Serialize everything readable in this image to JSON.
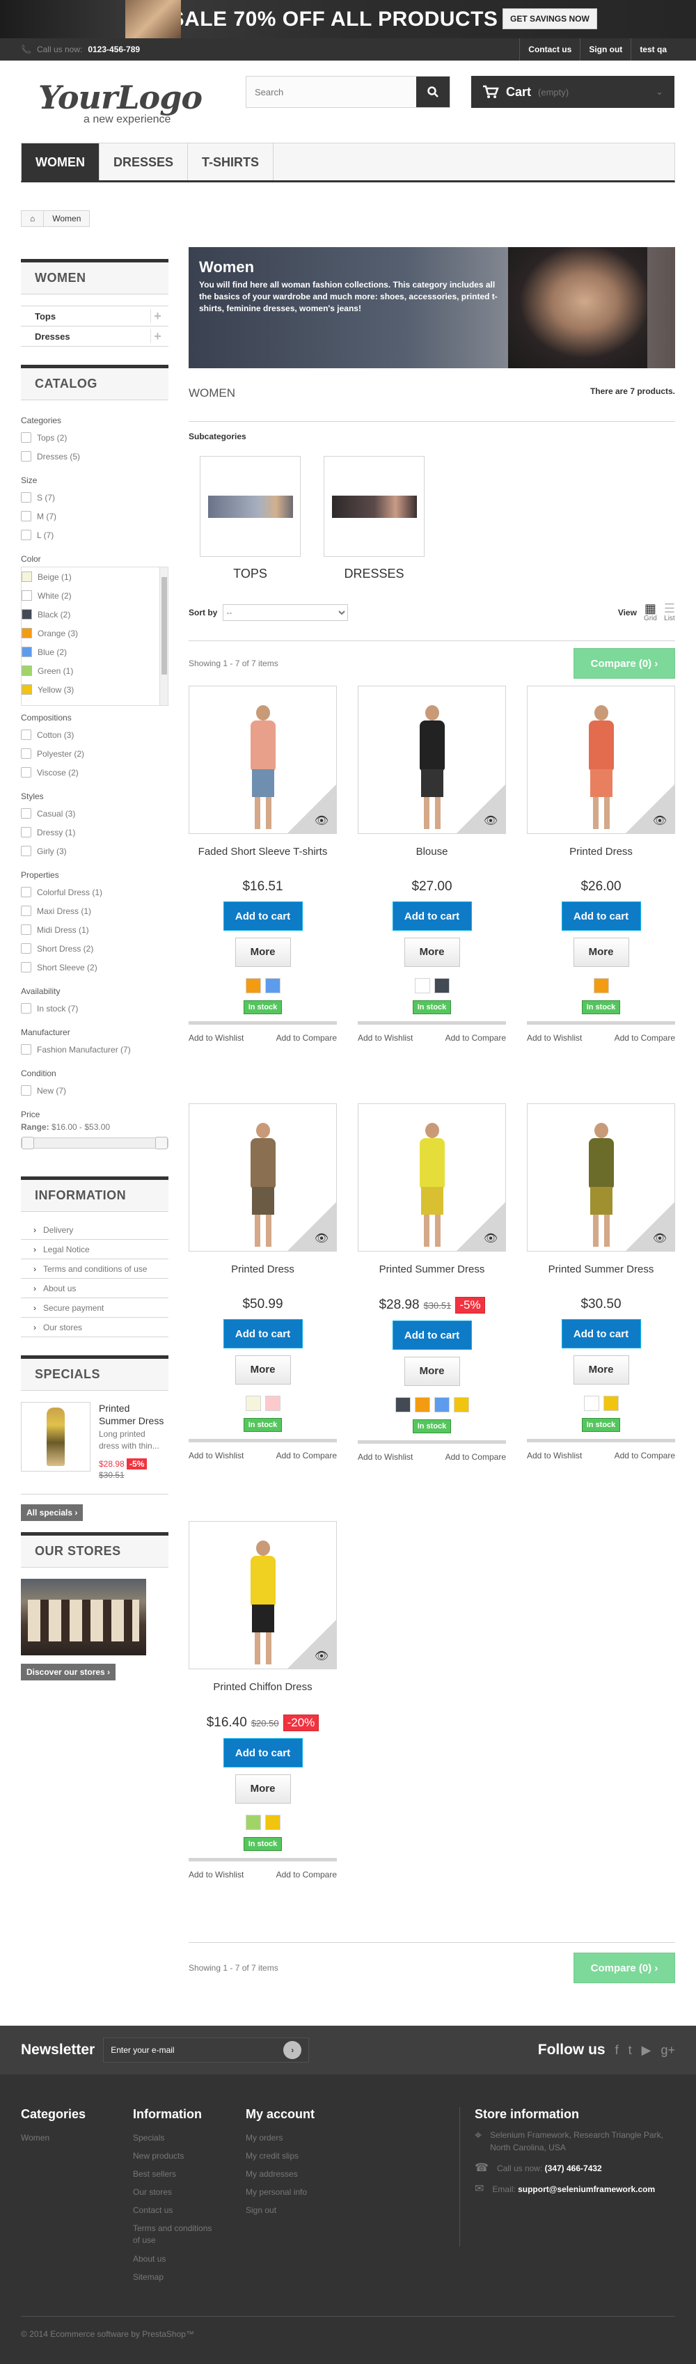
{
  "banner": {
    "sale": "SALE 70% OFF ALL PRODUCTS",
    "cta": "GET SAVINGS NOW"
  },
  "nav": {
    "call_label": "Call us now:",
    "phone": "0123-456-789",
    "links": [
      "Contact us",
      "Sign out",
      "test qa"
    ]
  },
  "header": {
    "logo_text": "YourLogo",
    "logo_tagline": "a new experience",
    "search_placeholder": "Search",
    "cart_label": "Cart",
    "cart_state": "(empty)"
  },
  "menu": [
    "WOMEN",
    "DRESSES",
    "T-SHIRTS"
  ],
  "breadcrumb": "Women",
  "sidebar": {
    "women_title": "WOMEN",
    "categories": [
      "Tops",
      "Dresses"
    ],
    "catalog_title": "CATALOG",
    "facets": {
      "categories_label": "Categories",
      "categories": [
        "Tops (2)",
        "Dresses (5)"
      ],
      "size_label": "Size",
      "sizes": [
        "S (7)",
        "M (7)",
        "L (7)"
      ],
      "color_label": "Color",
      "colors": [
        {
          "label": "Beige (1)",
          "hex": "#f5f5dc"
        },
        {
          "label": "White (2)",
          "hex": "#ffffff"
        },
        {
          "label": "Black (2)",
          "hex": "#434A54"
        },
        {
          "label": "Orange (3)",
          "hex": "#F39C11"
        },
        {
          "label": "Blue (2)",
          "hex": "#5D9CEC"
        },
        {
          "label": "Green (1)",
          "hex": "#A0D468"
        },
        {
          "label": "Yellow (3)",
          "hex": "#F1C40F"
        }
      ],
      "compositions_label": "Compositions",
      "compositions": [
        "Cotton (3)",
        "Polyester (2)",
        "Viscose (2)"
      ],
      "styles_label": "Styles",
      "styles": [
        "Casual (3)",
        "Dressy (1)",
        "Girly (3)"
      ],
      "properties_label": "Properties",
      "properties": [
        "Colorful Dress (1)",
        "Maxi Dress (1)",
        "Midi Dress (1)",
        "Short Dress (2)",
        "Short Sleeve (2)"
      ],
      "availability_label": "Availability",
      "availability": [
        "In stock (7)"
      ],
      "manufacturer_label": "Manufacturer",
      "manufacturer": [
        "Fashion Manufacturer (7)"
      ],
      "condition_label": "Condition",
      "condition": [
        "New (7)"
      ],
      "price_label": "Price",
      "range_label": "Range:",
      "range": "$16.00 - $53.00"
    },
    "info_title": "INFORMATION",
    "info_links": [
      "Delivery",
      "Legal Notice",
      "Terms and conditions of use",
      "About us",
      "Secure payment",
      "Our stores"
    ],
    "specials_title": "SPECIALS",
    "special": {
      "name": "Printed Summer Dress",
      "desc": "Long printed dress with thin...",
      "price": "$28.98",
      "pct": "-5%",
      "old": "$30.51"
    },
    "all_specials": "All specials",
    "stores_title": "OUR STORES",
    "discover": "Discover our stores"
  },
  "category": {
    "title": "Women",
    "desc": "You will find here all woman fashion collections. This category includes all the basics of your wardrobe and much more: shoes, accessories, printed t-shirts, feminine dresses, women's jeans!",
    "heading": "WOMEN",
    "count": "There are 7 products.",
    "subcategories_label": "Subcategories",
    "subcategories": [
      "TOPS",
      "DRESSES"
    ],
    "sort_label": "Sort by",
    "sort_value": "--",
    "view_label": "View",
    "grid": "Grid",
    "list": "List",
    "showing": "Showing 1 - 7 of 7 items",
    "compare": "Compare (0)"
  },
  "product_labels": {
    "add": "Add to cart",
    "more": "More",
    "stock": "In stock",
    "wishlist": "Add to Wishlist",
    "compare": "Add to Compare"
  },
  "products": [
    {
      "name": "Faded Short Sleeve T-shirts",
      "price": "$16.51",
      "old": "",
      "pct": "",
      "colors": [
        "#F39C11",
        "#5D9CEC"
      ]
    },
    {
      "name": "Blouse",
      "price": "$27.00",
      "old": "",
      "pct": "",
      "colors": [
        "#ffffff",
        "#434A54"
      ]
    },
    {
      "name": "Printed Dress",
      "price": "$26.00",
      "old": "",
      "pct": "",
      "colors": [
        "#F39C11"
      ]
    },
    {
      "name": "Printed Dress",
      "price": "$50.99",
      "old": "",
      "pct": "",
      "colors": [
        "#f5f5dc",
        "#FCCACD"
      ]
    },
    {
      "name": "Printed Summer Dress",
      "price": "$28.98",
      "old": "$30.51",
      "pct": "-5%",
      "colors": [
        "#434A54",
        "#F39C11",
        "#5D9CEC",
        "#F1C40F"
      ]
    },
    {
      "name": "Printed Summer Dress",
      "price": "$30.50",
      "old": "",
      "pct": "",
      "colors": [
        "#ffffff",
        "#F1C40F"
      ]
    },
    {
      "name": "Printed Chiffon Dress",
      "price": "$16.40",
      "old": "$20.50",
      "pct": "-20%",
      "colors": [
        "#A0D468",
        "#F1C40F"
      ]
    }
  ],
  "newsletter": {
    "label": "Newsletter",
    "placeholder": "Enter your e-mail",
    "follow": "Follow us"
  },
  "footer": {
    "categories_title": "Categories",
    "categories": [
      "Women"
    ],
    "info_title": "Information",
    "info": [
      "Specials",
      "New products",
      "Best sellers",
      "Our stores",
      "Contact us",
      "Terms and conditions of use",
      "About us",
      "Sitemap"
    ],
    "account_title": "My account",
    "account": [
      "My orders",
      "My credit slips",
      "My addresses",
      "My personal info",
      "Sign out"
    ],
    "store_title": "Store information",
    "address": "Selenium Framework, Research Triangle Park, North Carolina, USA",
    "call_label": "Call us now:",
    "phone": "(347) 466-7432",
    "email_label": "Email:",
    "email": "support@seleniumframework.com",
    "copyright": "© 2014 Ecommerce software by PrestaShop™"
  }
}
